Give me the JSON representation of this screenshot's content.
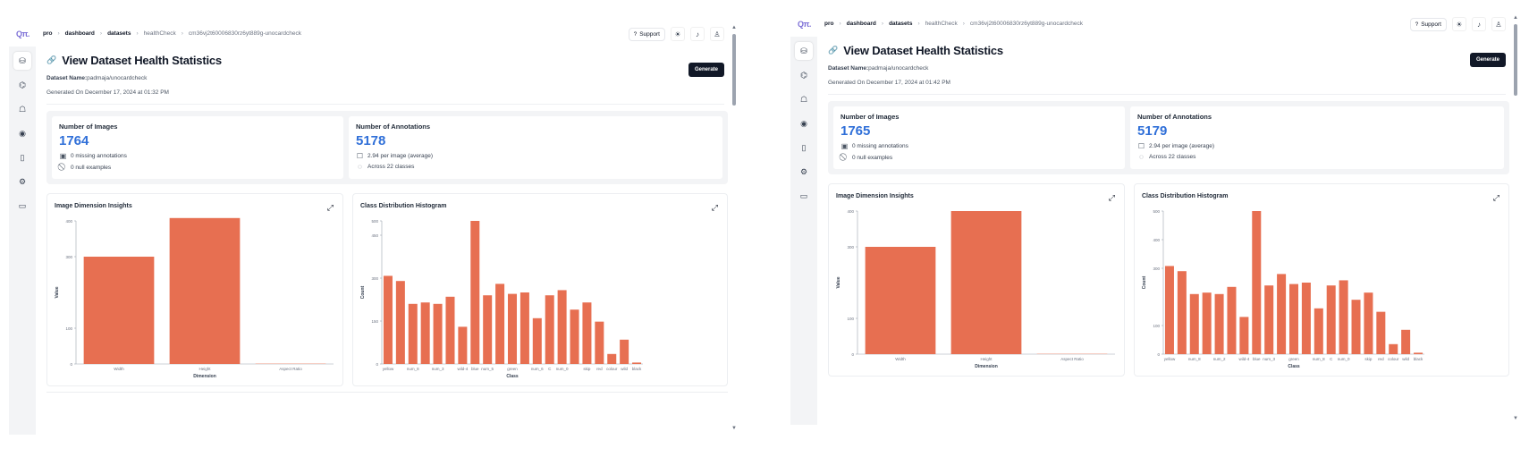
{
  "colors": {
    "bar": "#e76f51",
    "accent_value": "#2f6fd8",
    "primary_button": "#111827"
  },
  "screens": [
    {
      "logo": "Qπ.",
      "breadcrumb": [
        "pro",
        "dashboard",
        "datasets",
        "healthCheck",
        "cm36vj2t60006830rz6yt889g-unocardcheck"
      ],
      "support_label": "Support",
      "page_title": "View Dataset Health Statistics",
      "dataset_name_label": "Dataset Name:",
      "dataset_name": "padmaja/unocardcheck",
      "generated_on": "Generated On December 17, 2024 at 01:32 PM",
      "generate_label": "Generate",
      "images": {
        "label": "Number of Images",
        "value": "1764",
        "missing": "0 missing annotations",
        "null": "0 null examples"
      },
      "annotations": {
        "label": "Number of Annotations",
        "value": "5178",
        "per_image": "2.94 per image (average)",
        "classes": "Across 22 classes"
      },
      "dim_chart_title": "Image Dimension Insights",
      "class_chart_title": "Class Distribution Histogram"
    },
    {
      "logo": "Qπ.",
      "breadcrumb": [
        "pro",
        "dashboard",
        "datasets",
        "healthCheck",
        "cm36vj2t60006830rz6yt889g-unocardcheck"
      ],
      "support_label": "Support",
      "page_title": "View Dataset Health Statistics",
      "dataset_name_label": "Dataset Name:",
      "dataset_name": "padmaja/unocardcheck",
      "generated_on": "Generated On December 17, 2024 at 01:42 PM",
      "generate_label": "Generate",
      "images": {
        "label": "Number of Images",
        "value": "1765",
        "missing": "0 missing annotations",
        "null": "0 null examples"
      },
      "annotations": {
        "label": "Number of Annotations",
        "value": "5179",
        "per_image": "2.94 per image (average)",
        "classes": "Across 22 classes"
      },
      "dim_chart_title": "Image Dimension Insights",
      "class_chart_title": "Class Distribution Histogram"
    }
  ],
  "chart_data": [
    {
      "type": "bar",
      "title": "Image Dimension Insights",
      "xlabel": "Dimension",
      "ylabel": "Value",
      "categories": [
        "Width",
        "Height",
        "Aspect Ratio"
      ],
      "values": [
        300,
        408,
        1
      ],
      "ylim": [
        0,
        400
      ],
      "yticks": [
        0,
        100,
        300,
        400
      ]
    },
    {
      "type": "bar",
      "title": "Class Distribution Histogram",
      "xlabel": "Class",
      "ylabel": "Count",
      "categories": [
        "yellow",
        "",
        "num_8",
        "",
        "num_3",
        "",
        "wild-4",
        "blue",
        "num_5",
        "",
        "green",
        "",
        "num_6",
        "C",
        "num_0",
        "",
        "skip",
        "red",
        "colour",
        "wild",
        "black"
      ],
      "tick_labels": [
        "yellow",
        "num_8",
        "num_3",
        "wild-4",
        "blue",
        "num_5",
        "green",
        "num_6",
        "C",
        "num_0",
        "skip",
        "red",
        "colour",
        "wild",
        "black"
      ],
      "values": [
        308,
        290,
        210,
        215,
        210,
        235,
        130,
        500,
        240,
        280,
        245,
        250,
        160,
        240,
        258,
        190,
        215,
        148,
        35,
        85,
        5
      ],
      "ylim": [
        0,
        500
      ],
      "yticks": [
        0,
        150,
        300,
        450,
        500
      ]
    },
    {
      "type": "bar",
      "title": "Image Dimension Insights",
      "xlabel": "Dimension",
      "ylabel": "Value",
      "categories": [
        "Width",
        "Height",
        "Aspect Ratio"
      ],
      "values": [
        300,
        400,
        1
      ],
      "ylim": [
        0,
        400
      ],
      "yticks": [
        0,
        100,
        300,
        400
      ]
    },
    {
      "type": "bar",
      "title": "Class Distribution Histogram",
      "xlabel": "Class",
      "ylabel": "Count",
      "categories": [
        "yellow",
        "",
        "num_8",
        "",
        "num_2",
        "",
        "wild-4",
        "blue",
        "num_3",
        "",
        "green",
        "",
        "num_8",
        "C",
        "num_0",
        "",
        "skip",
        "red",
        "colour",
        "wild",
        "black"
      ],
      "tick_labels": [
        "yellow",
        "num_8",
        "num_2",
        "wild-4",
        "blue",
        "num_3",
        "green",
        "num_8",
        "C",
        "num_0",
        "skip",
        "red",
        "colour",
        "wild",
        "black"
      ],
      "values": [
        308,
        290,
        210,
        215,
        210,
        235,
        130,
        500,
        240,
        280,
        245,
        250,
        160,
        240,
        258,
        190,
        215,
        148,
        35,
        85,
        5
      ],
      "ylim": [
        0,
        500
      ],
      "yticks": [
        0,
        100,
        300,
        400,
        500
      ]
    }
  ]
}
